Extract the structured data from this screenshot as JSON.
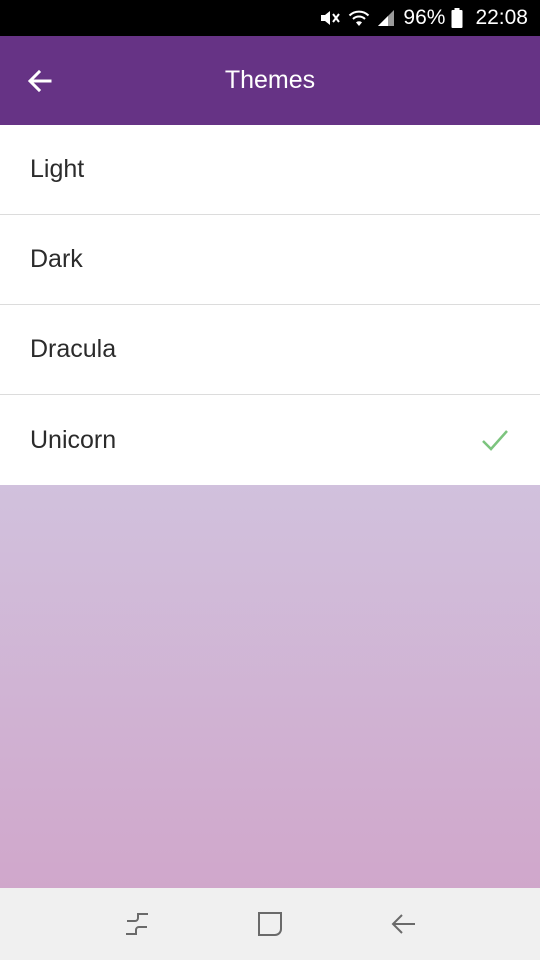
{
  "status_bar": {
    "battery": "96%",
    "time": "22:08",
    "icons": [
      "mute-icon",
      "wifi-icon",
      "signal-icon",
      "battery-icon"
    ]
  },
  "app_bar": {
    "title": "Themes",
    "back_icon": "arrow-back-icon",
    "color": "#663385"
  },
  "themes": [
    {
      "label": "Light",
      "selected": false
    },
    {
      "label": "Dark",
      "selected": false
    },
    {
      "label": "Dracula",
      "selected": false
    },
    {
      "label": "Unicorn",
      "selected": true
    }
  ],
  "colors": {
    "check": "#7cc47e",
    "gradient_top": "#d1c1dd",
    "gradient_bottom": "#d0a7cb"
  },
  "nav_bar": {
    "icons": [
      "recent-apps-icon",
      "home-icon",
      "back-icon"
    ]
  }
}
